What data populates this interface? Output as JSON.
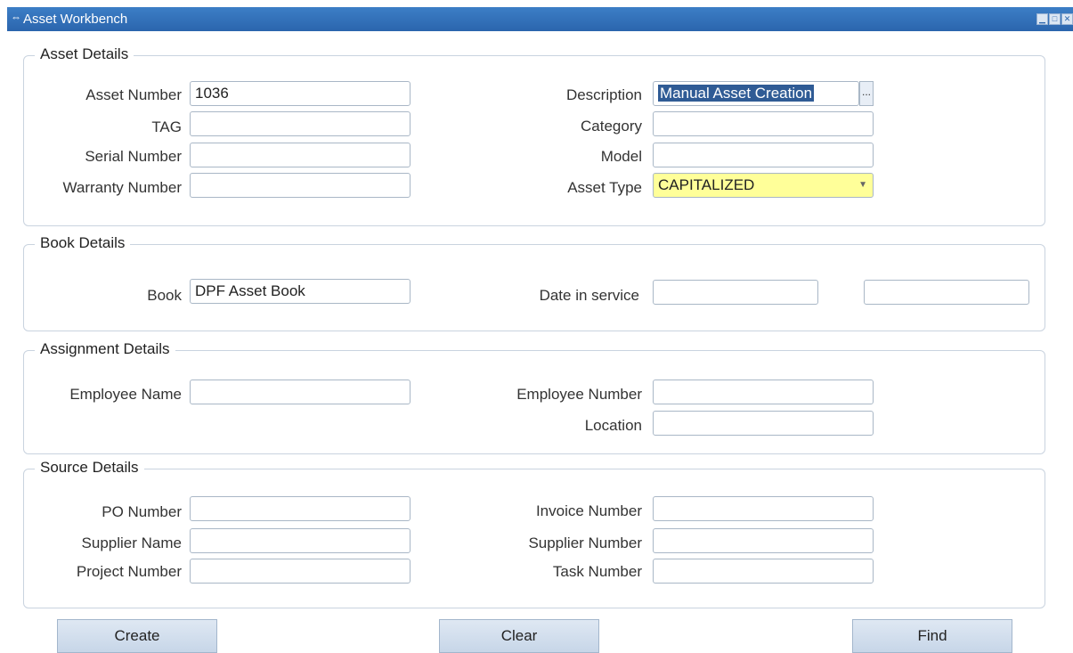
{
  "window": {
    "title": "Asset Workbench",
    "controls": [
      "minimize-icon",
      "restore-icon",
      "close-icon"
    ]
  },
  "asset_details": {
    "title": "Asset Details",
    "asset_number_label": "Asset Number",
    "asset_number_value": "1036",
    "tag_label": "TAG",
    "serial_number_label": "Serial Number",
    "warranty_number_label": "Warranty Number",
    "description_label": "Description",
    "description_value": "Manual Asset Creation",
    "lov_button": "...",
    "category_label": "Category",
    "model_label": "Model",
    "asset_type_label": "Asset Type",
    "asset_type_value": "CAPITALIZED"
  },
  "book_details": {
    "title": "Book Details",
    "book_label": "Book",
    "book_value": "DPF Asset Book",
    "date_in_service_label": "Date in service"
  },
  "assignment_details": {
    "title": "Assignment Details",
    "employee_name_label": "Employee Name",
    "employee_number_label": "Employee Number",
    "location_label": "Location"
  },
  "source_details": {
    "title": "Source Details",
    "po_number_label": "PO Number",
    "supplier_name_label": "Supplier Name",
    "project_number_label": "Project Number",
    "invoice_number_label": "Invoice Number",
    "supplier_number_label": "Supplier Number",
    "task_number_label": "Task Number"
  },
  "buttons": {
    "create": "Create",
    "clear": "Clear",
    "find": "Find"
  },
  "colors": {
    "titlebar": "#2b65ad",
    "selection": "#2f5b95",
    "required_field": "#ffff99",
    "button": "#c7d6e8"
  }
}
